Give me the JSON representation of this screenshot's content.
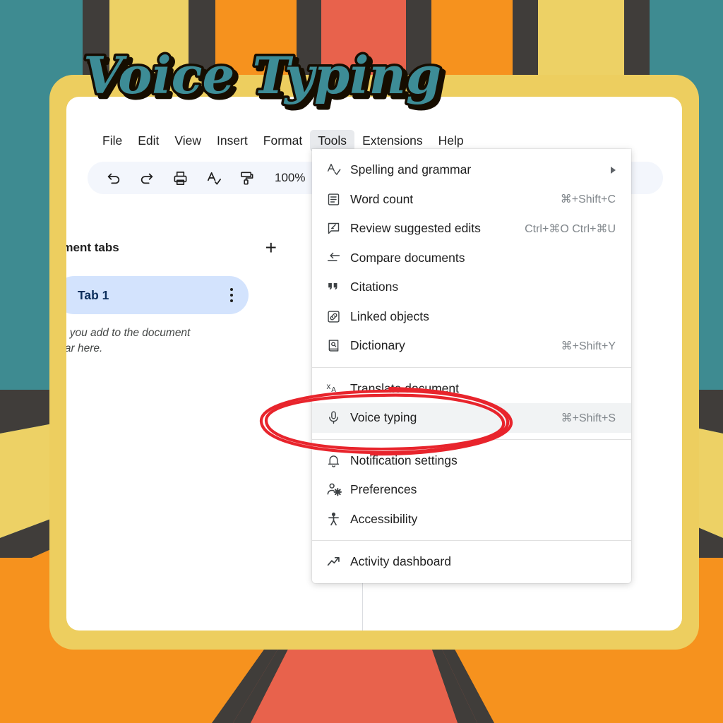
{
  "title_overlay": {
    "text": "Voice Typing",
    "fill_color": "#3c8c96",
    "outline_color": "#140d06"
  },
  "background": {
    "colors": {
      "teal": "#3e8b91",
      "dark": "#403d3a",
      "yellow": "#edd165",
      "orange": "#f6921e",
      "red": "#e8624c",
      "frame_yellow": "#edce5f"
    }
  },
  "menubar": {
    "items": [
      {
        "label": "File",
        "active": false
      },
      {
        "label": "Edit",
        "active": false
      },
      {
        "label": "View",
        "active": false
      },
      {
        "label": "Insert",
        "active": false
      },
      {
        "label": "Format",
        "active": false
      },
      {
        "label": "Tools",
        "active": true
      },
      {
        "label": "Extensions",
        "active": false
      },
      {
        "label": "Help",
        "active": false
      }
    ]
  },
  "toolbar": {
    "buttons": [
      {
        "icon": "undo-icon",
        "name": "undo-button"
      },
      {
        "icon": "redo-icon",
        "name": "redo-button"
      },
      {
        "icon": "print-icon",
        "name": "print-button"
      },
      {
        "icon": "spellcheck-icon",
        "name": "spellcheck-button"
      },
      {
        "icon": "paint-format-icon",
        "name": "paint-format-button"
      }
    ],
    "zoom_value": "100%"
  },
  "sidebar": {
    "heading": "ument tabs",
    "add_label": "+",
    "tab": {
      "label": "Tab 1"
    },
    "hint_line1": "ings you add to the document",
    "hint_line2": "ppear here."
  },
  "menu": {
    "groups": [
      {
        "items": [
          {
            "icon": "spelling-grammar-icon",
            "label": "Spelling and grammar",
            "shortcut": "",
            "submenu": true,
            "highlight": false
          },
          {
            "icon": "word-count-icon",
            "label": "Word count",
            "shortcut": "⌘+Shift+C",
            "submenu": false,
            "highlight": false
          },
          {
            "icon": "review-edits-icon",
            "label": "Review suggested edits",
            "shortcut": "Ctrl+⌘O Ctrl+⌘U",
            "submenu": false,
            "highlight": false
          },
          {
            "icon": "compare-documents-icon",
            "label": "Compare documents",
            "shortcut": "",
            "submenu": false,
            "highlight": false
          },
          {
            "icon": "citations-icon",
            "label": "Citations",
            "shortcut": "",
            "submenu": false,
            "highlight": false
          },
          {
            "icon": "linked-objects-icon",
            "label": "Linked objects",
            "shortcut": "",
            "submenu": false,
            "highlight": false
          },
          {
            "icon": "dictionary-icon",
            "label": "Dictionary",
            "shortcut": "⌘+Shift+Y",
            "submenu": false,
            "highlight": false
          }
        ]
      },
      {
        "items": [
          {
            "icon": "translate-icon",
            "label": "Translate document",
            "shortcut": "",
            "submenu": false,
            "highlight": false
          },
          {
            "icon": "microphone-icon",
            "label": "Voice typing",
            "shortcut": "⌘+Shift+S",
            "submenu": false,
            "highlight": true
          }
        ]
      },
      {
        "items": [
          {
            "icon": "bell-icon",
            "label": "Notification settings",
            "shortcut": "",
            "submenu": false,
            "highlight": false
          },
          {
            "icon": "preferences-icon",
            "label": "Preferences",
            "shortcut": "",
            "submenu": false,
            "highlight": false
          },
          {
            "icon": "accessibility-icon",
            "label": "Accessibility",
            "shortcut": "",
            "submenu": false,
            "highlight": false
          }
        ]
      },
      {
        "items": [
          {
            "icon": "activity-dashboard-icon",
            "label": "Activity dashboard",
            "shortcut": "",
            "submenu": false,
            "highlight": false
          }
        ]
      }
    ]
  },
  "annotation": {
    "shape": "hand-drawn-ellipse",
    "color": "#e8242c",
    "targets": "Voice typing"
  }
}
